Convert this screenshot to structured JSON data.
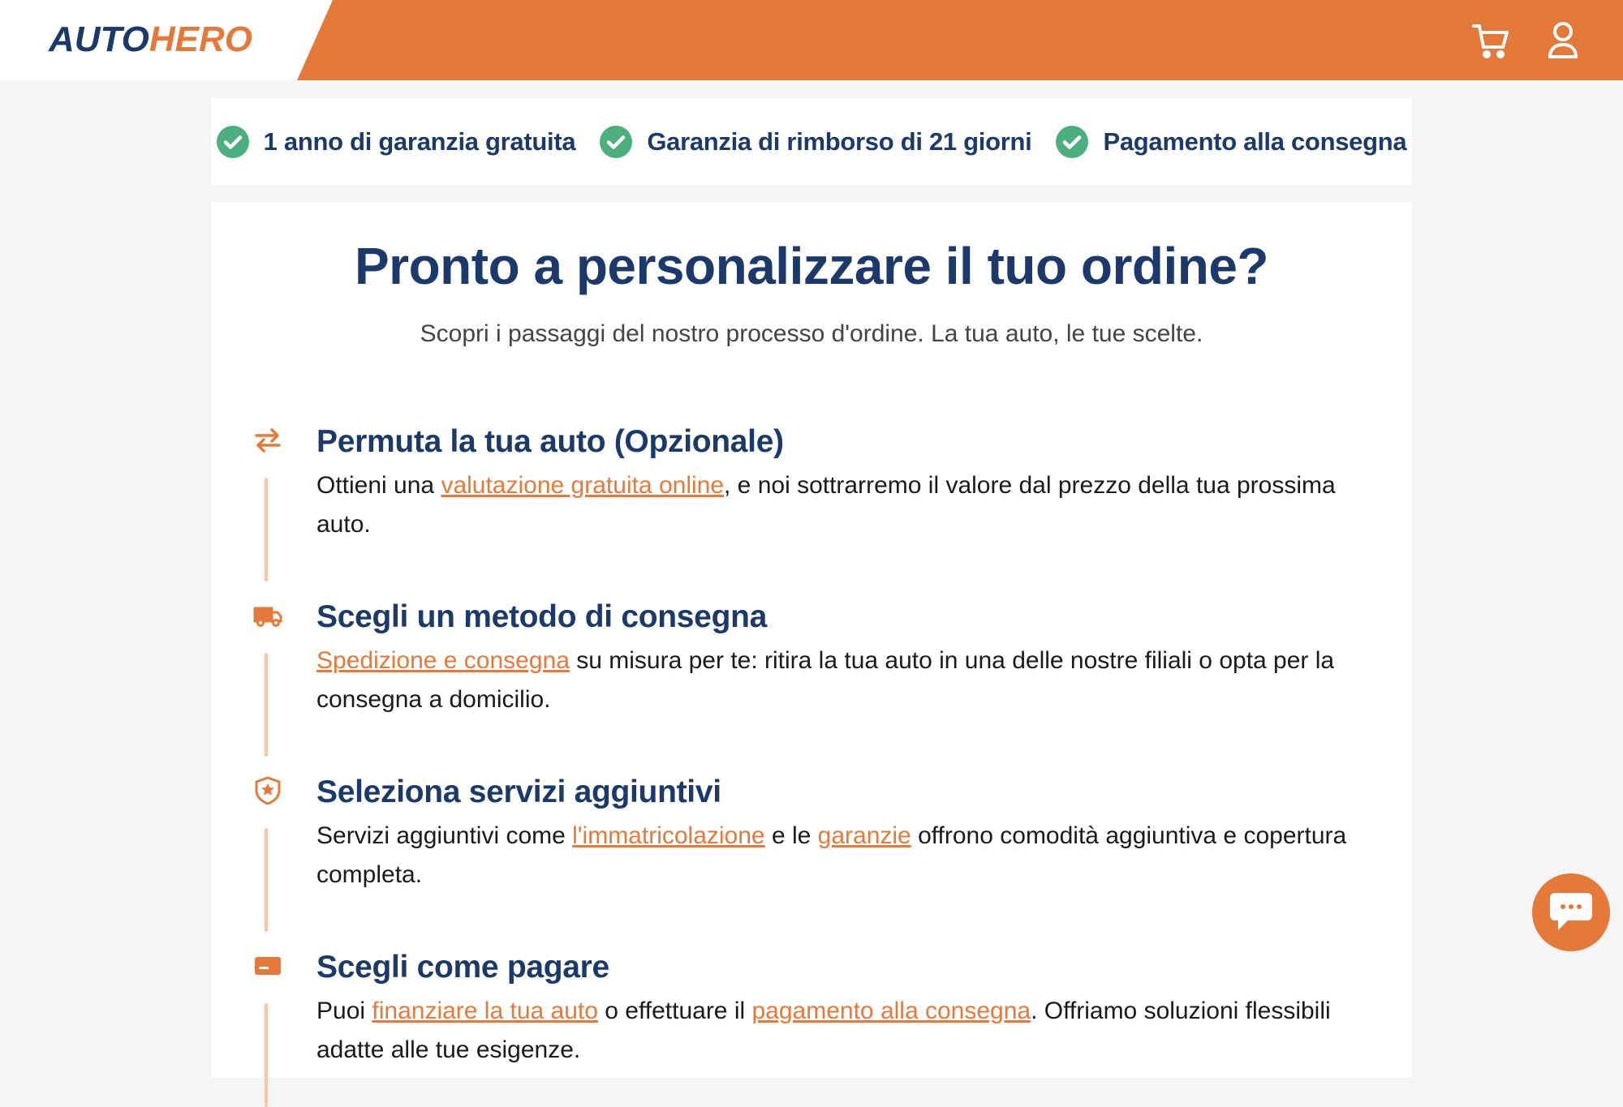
{
  "header": {
    "logo_part1": "AUTO",
    "logo_part2": "HERO",
    "brand_color": "#e5793a",
    "navy_color": "#1b3a6b",
    "icons": [
      "cart-icon",
      "user-icon"
    ]
  },
  "usp": [
    {
      "icon": "check-circle-icon",
      "label": "1 anno di garanzia gratuita"
    },
    {
      "icon": "check-circle-icon",
      "label": "Garanzia di rimborso di 21 giorni"
    },
    {
      "icon": "check-circle-icon",
      "label": "Pagamento alla consegna"
    }
  ],
  "main": {
    "title": "Pronto a personalizzare il tuo ordine?",
    "subtitle": "Scopri i passaggi del nostro processo d'ordine. La tua auto, le tue scelte.",
    "steps": [
      {
        "icon": "swap-arrows-icon",
        "title": "Permuta la tua auto (Opzionale)",
        "body": {
          "t1": "Ottieni una ",
          "link1": "valutazione gratuita online",
          "t2": ", e noi sottrarremo il valore dal prezzo della tua prossima auto."
        }
      },
      {
        "icon": "truck-icon",
        "title": "Scegli un metodo di consegna",
        "body": {
          "link1": "Spedizione e consegna",
          "t1": " su misura per te: ritira la tua auto in una delle nostre filiali o opta per la consegna a domicilio."
        }
      },
      {
        "icon": "shield-star-icon",
        "title": "Seleziona servizi aggiuntivi",
        "body": {
          "t1": "Servizi aggiuntivi come ",
          "link1": "l'immatricolazione",
          "t2": " e le ",
          "link2": "garanzie",
          "t3": " offrono comodità aggiuntiva e copertura completa."
        }
      },
      {
        "icon": "card-icon",
        "title": "Scegli come pagare",
        "body": {
          "t1": "Puoi ",
          "link1": "finanziare la tua auto",
          "t2": " o effettuare il ",
          "link2": "pagamento alla consegna",
          "t3": ". Offriamo soluzioni flessibili adatte alle tue esigenze."
        }
      }
    ]
  },
  "chat": {
    "icon": "chat-bubble-icon"
  }
}
